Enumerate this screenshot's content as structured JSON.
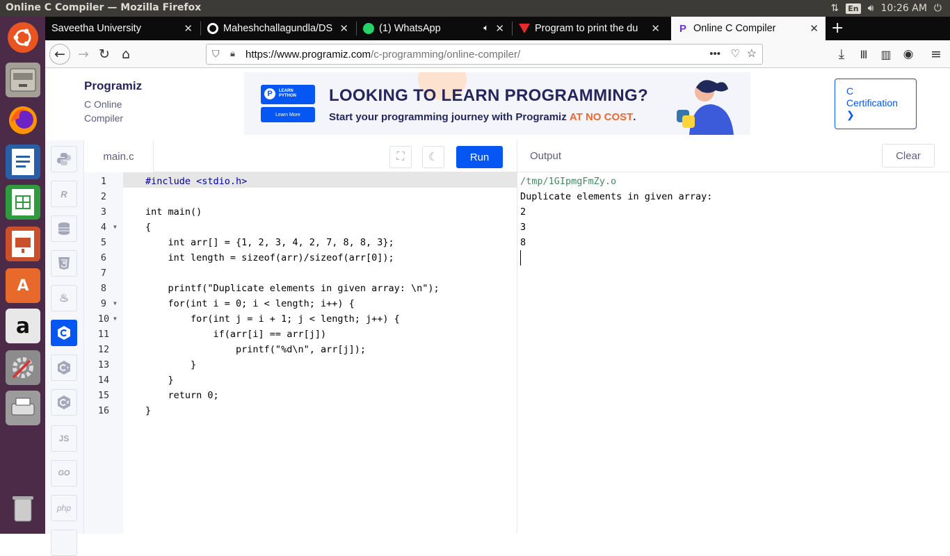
{
  "os": {
    "window_title": "Online C Compiler — Mozilla Firefox",
    "keyboard_layout": "En",
    "clock": "10:26 AM"
  },
  "tabs": [
    {
      "label": "Saveetha University",
      "icon": "page-icon"
    },
    {
      "label": "Maheshchallagundla/DS",
      "icon": "github-icon"
    },
    {
      "label": "(1) WhatsApp",
      "icon": "whatsapp-icon"
    },
    {
      "label": "Program to print the du",
      "icon": "javatpoint-icon"
    },
    {
      "label": "Online C Compiler",
      "icon": "programiz-icon",
      "active": true
    }
  ],
  "navbar": {
    "url_host": "https://www.programiz.com",
    "url_path": "/c-programming/online-compiler/",
    "page_actions": "•••"
  },
  "site": {
    "logo": "Programiz",
    "subtitle_line1": "C Online",
    "subtitle_line2": "Compiler",
    "banner": {
      "badge_line1": "LEARN",
      "badge_line2": "PYTHON",
      "button": "Learn More",
      "headline": "LOOKING TO LEARN PROGRAMMING?",
      "sub_prefix": "Start your programming journey with Programiz ",
      "sub_highlight": "AT NO COST",
      "sub_suffix": "."
    },
    "cert_line1": "C",
    "cert_line2": "Certification",
    "cert_arrow": "❯"
  },
  "languages": [
    "python",
    "r",
    "sql",
    "html5",
    "java",
    "c",
    "cpp",
    "csharp",
    "JS",
    "GO",
    "php"
  ],
  "editor": {
    "filename": "main.c",
    "run_label": "Run",
    "lines": [
      "#include <stdio.h>",
      "",
      "int main()",
      "{",
      "    int arr[] = {1, 2, 3, 4, 2, 7, 8, 8, 3};",
      "    int length = sizeof(arr)/sizeof(arr[0]);",
      "",
      "    printf(\"Duplicate elements in given array: \\n\");",
      "    for(int i = 0; i < length; i++) {",
      "        for(int j = i + 1; j < length; j++) {",
      "            if(arr[i] == arr[j])",
      "                printf(\"%d\\n\", arr[j]);",
      "        }",
      "    }",
      "    return 0;",
      "}"
    ],
    "line_numbers": [
      "1",
      "2",
      "3",
      "4",
      "5",
      "6",
      "7",
      "8",
      "9",
      "10",
      "11",
      "12",
      "13",
      "14",
      "15",
      "16"
    ]
  },
  "output": {
    "label": "Output",
    "clear_label": "Clear",
    "path": "/tmp/1GIpmgFmZy.o",
    "lines": [
      "Duplicate elements in given array:",
      "2",
      "3",
      "8"
    ]
  }
}
